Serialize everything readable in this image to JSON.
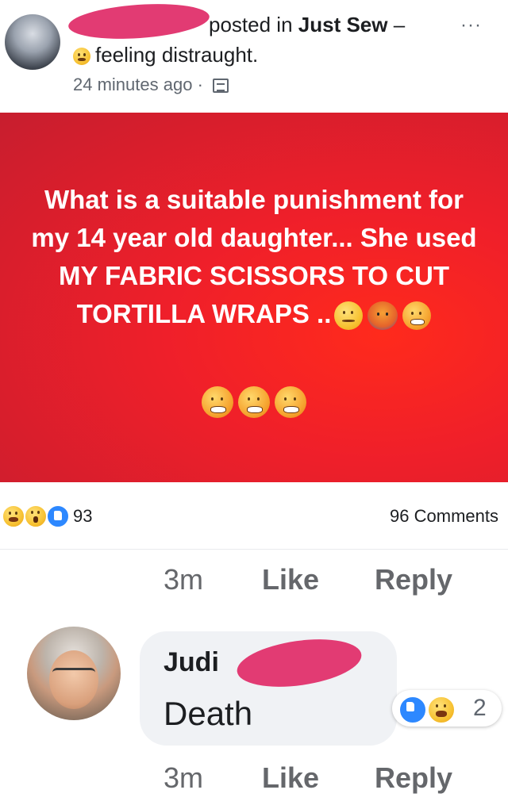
{
  "post": {
    "posted_in_text": "posted in",
    "group_name": "Just Sew",
    "group_dash": "–",
    "more_label": "···",
    "feeling_text": "feeling distraught.",
    "time_text": "24 minutes ago",
    "time_separator": "·",
    "banner_text": "What is a suitable punishment for my 14 year old daughter... She used MY FABRIC SCISSORS TO CUT TORTILLA WRAPS ..",
    "banner_color": "#e8202a"
  },
  "reactions": {
    "count": "93",
    "comments_label": "96 Comments",
    "types": [
      "haha-icon",
      "wow-icon",
      "like-icon"
    ]
  },
  "first_comment_actions": {
    "time": "3m",
    "like": "Like",
    "reply": "Reply"
  },
  "comment": {
    "author_name": "Judi",
    "text": "Death",
    "reaction_count": "2",
    "actions": {
      "time": "3m",
      "like": "Like",
      "reply": "Reply"
    }
  },
  "colors": {
    "like_blue": "#2d88ff",
    "muted_text": "#65676b",
    "redaction_pink": "#e23b73"
  }
}
